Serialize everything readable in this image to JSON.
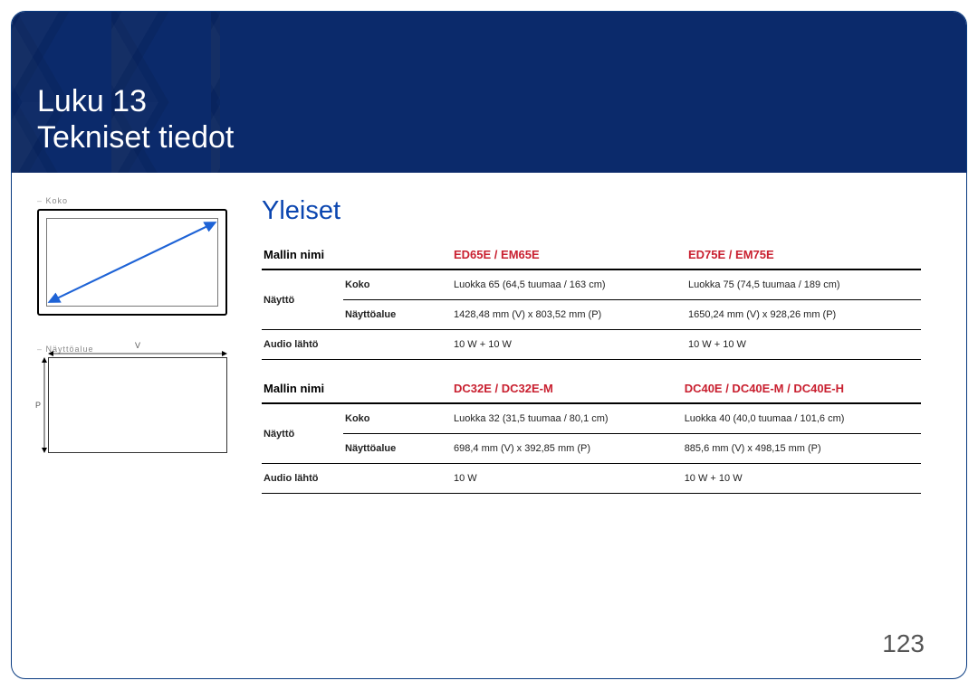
{
  "banner": {
    "chapter": "Luku 13",
    "title": "Tekniset tiedot"
  },
  "side": {
    "koko_caption": "Koko",
    "nayttoalue_caption": "Näyttöalue",
    "dim_v": "V",
    "dim_p": "P"
  },
  "section_heading": "Yleiset",
  "labels": {
    "mallin_nimi": "Mallin nimi",
    "naytto": "Näyttö",
    "koko": "Koko",
    "nayttoalue": "Näyttöalue",
    "audio_lahto": "Audio lähtö"
  },
  "tables": [
    {
      "model_a": "ED65E / EM65E",
      "model_b": "ED75E / EM75E",
      "rows": {
        "naytto_koko": {
          "a": "Luokka 65 (64,5 tuumaa / 163 cm)",
          "b": "Luokka 75 (74,5 tuumaa / 189 cm)"
        },
        "naytto_alue": {
          "a": "1428,48 mm (V) x 803,52 mm (P)",
          "b": "1650,24 mm (V) x 928,26 mm (P)"
        },
        "audio": {
          "a": "10 W + 10 W",
          "b": "10 W + 10 W"
        }
      }
    },
    {
      "model_a": "DC32E / DC32E-M",
      "model_b": "DC40E / DC40E-M / DC40E-H",
      "rows": {
        "naytto_koko": {
          "a": "Luokka 32 (31,5 tuumaa / 80,1 cm)",
          "b": "Luokka 40 (40,0 tuumaa / 101,6 cm)"
        },
        "naytto_alue": {
          "a": "698,4 mm (V) x 392,85 mm (P)",
          "b": "885,6 mm (V) x 498,15 mm (P)"
        },
        "audio": {
          "a": "10 W",
          "b": "10 W + 10 W"
        }
      }
    }
  ],
  "page_number": "123"
}
